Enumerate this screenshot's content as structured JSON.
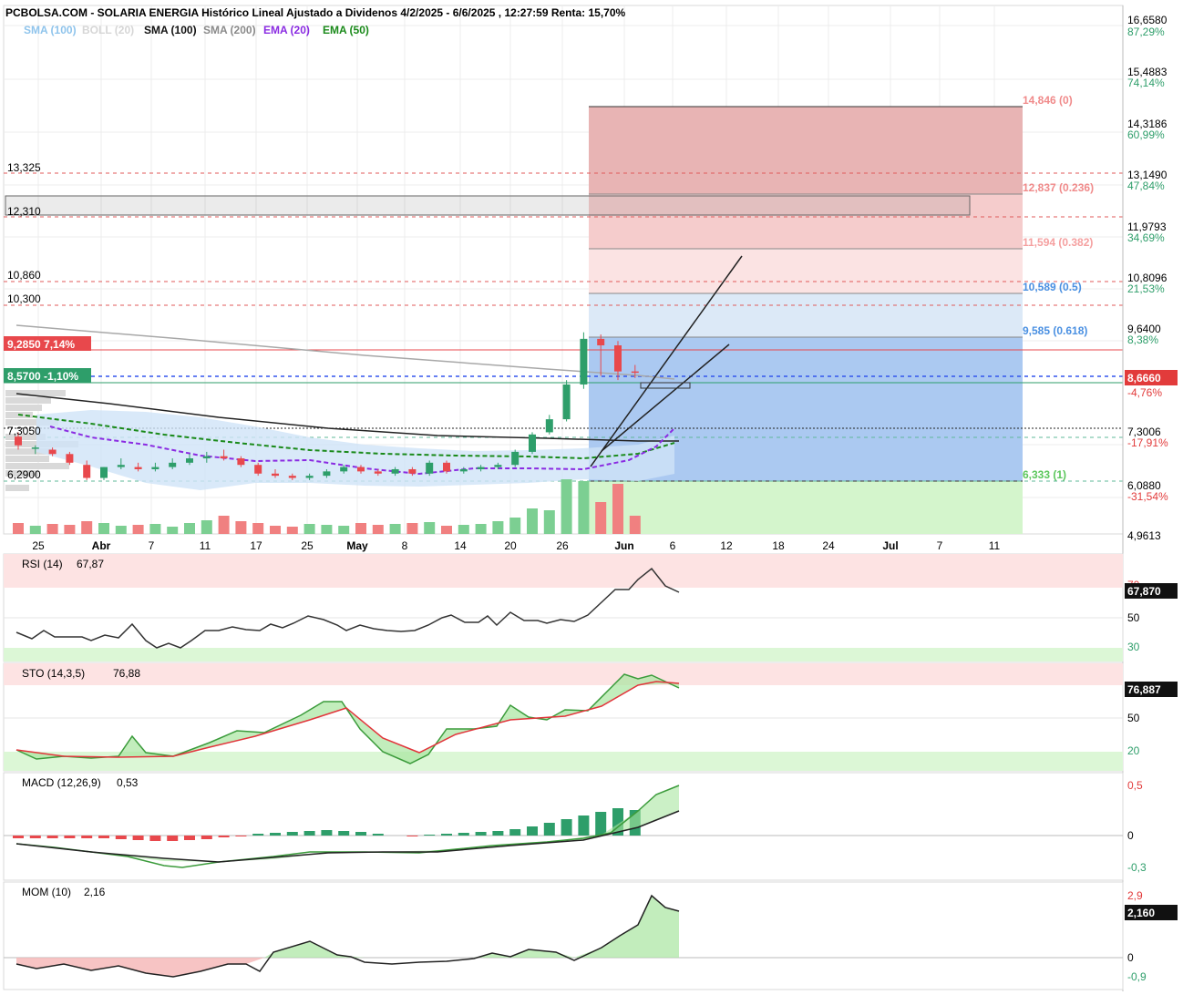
{
  "header": {
    "title": "PCBOLSA.COM - SOLARIA ENERGIA Histórico Lineal Ajustado a Dividenos 4/2/2025 - 6/6/2025 , 12:27:59 Renta: 15,70%",
    "legend": [
      {
        "label": "SMA (100)",
        "color": "#8fc4ec"
      },
      {
        "label": "BOLL (20)",
        "color": "#d6d6d6"
      },
      {
        "label": "SMA (100)",
        "color": "#111111"
      },
      {
        "label": "SMA (200)",
        "color": "#8a8a8a"
      },
      {
        "label": "EMA (20)",
        "color": "#8a2be2"
      },
      {
        "label": "EMA (50)",
        "color": "#1a8a1a"
      }
    ]
  },
  "price_axis": [
    {
      "price": "16,6580",
      "pct": "87,29%"
    },
    {
      "price": "15,4883",
      "pct": "74,14%"
    },
    {
      "price": "14,3186",
      "pct": "60,99%"
    },
    {
      "price": "13,1490",
      "pct": "47,84%"
    },
    {
      "price": "11,9793",
      "pct": "34,69%"
    },
    {
      "price": "10,8096",
      "pct": "21,53%"
    },
    {
      "price": "9,6400",
      "pct": "8,38%"
    },
    {
      "price": "7,3006",
      "pct": "-17,91%"
    },
    {
      "price": "6,0880",
      "pct": "-31,54%"
    },
    {
      "price": "4,9613",
      "pct": ""
    }
  ],
  "current_price": {
    "value": "8,6660",
    "pct": "-4,76%",
    "color": "#e23b3b"
  },
  "left_tags": [
    {
      "label": "13,325"
    },
    {
      "label": "12,310"
    },
    {
      "label": "10,860"
    },
    {
      "label": "10,300"
    },
    {
      "label": "9,2850  7,14%",
      "bg": "#e8484c"
    },
    {
      "label": "8,5700  -1,10%",
      "bg": "#2e9e6a"
    },
    {
      "label": "7,3050"
    },
    {
      "label": "6,2900"
    }
  ],
  "fib_levels": [
    {
      "label": "14,846 (0)",
      "color": "#f08a8a"
    },
    {
      "label": "12,837 (0.236)",
      "color": "#f08a8a"
    },
    {
      "label": "11,594 (0.382)",
      "color": "#f5a0a0"
    },
    {
      "label": "10,589 (0.5)",
      "color": "#4a90e2"
    },
    {
      "label": "9,585 (0.618)",
      "color": "#4a90e2"
    },
    {
      "label": "6,333 (1)",
      "color": "#5cc75c"
    }
  ],
  "x_axis": [
    "25",
    "Abr",
    "7",
    "11",
    "17",
    "25",
    "May",
    "8",
    "14",
    "20",
    "26",
    "Jun",
    "6",
    "12",
    "18",
    "24",
    "Jul",
    "7",
    "11"
  ],
  "panels": {
    "rsi": {
      "label": "RSI (14)",
      "value": "67,87",
      "tag": "67,870",
      "levels": [
        "70",
        "50",
        "30"
      ]
    },
    "sto": {
      "label": "STO (14,3,5)",
      "value": "76,88",
      "tag": "76,887",
      "levels": [
        "50",
        "20"
      ]
    },
    "macd": {
      "label": "MACD (12,26,9)",
      "value": "0,53",
      "levels": [
        "0,5",
        "0",
        "-0,3"
      ]
    },
    "mom": {
      "label": "MOM (10)",
      "value": "2,16",
      "tag": "2,160",
      "levels": [
        "2,9",
        "0",
        "-0,9"
      ]
    }
  },
  "colors": {
    "up": "#2e9e6a",
    "down": "#e8484c",
    "grid": "#e6e6e6"
  },
  "chart_data": {
    "type": "candlestick",
    "title": "SOLARIA ENERGIA Histórico Lineal Ajustado a Dividenos 4/2/2025 - 6/6/2025",
    "ylim": [
      4.9613,
      16.658
    ],
    "candles": [
      [
        7.2,
        7.3,
        6.9,
        7.0
      ],
      [
        6.95,
        7.0,
        6.8,
        6.95
      ],
      [
        6.9,
        6.95,
        6.75,
        6.8
      ],
      [
        6.8,
        6.85,
        6.55,
        6.6
      ],
      [
        6.55,
        6.65,
        6.2,
        6.25
      ],
      [
        6.25,
        6.5,
        6.2,
        6.5
      ],
      [
        6.5,
        6.7,
        6.45,
        6.55
      ],
      [
        6.5,
        6.6,
        6.4,
        6.45
      ],
      [
        6.45,
        6.6,
        6.4,
        6.5
      ],
      [
        6.5,
        6.7,
        6.45,
        6.6
      ],
      [
        6.6,
        6.8,
        6.55,
        6.7
      ],
      [
        6.7,
        6.85,
        6.6,
        6.75
      ],
      [
        6.75,
        6.9,
        6.65,
        6.7
      ],
      [
        6.7,
        6.75,
        6.5,
        6.55
      ],
      [
        6.55,
        6.6,
        6.3,
        6.35
      ],
      [
        6.35,
        6.45,
        6.25,
        6.3
      ],
      [
        6.3,
        6.35,
        6.2,
        6.25
      ],
      [
        6.25,
        6.35,
        6.2,
        6.3
      ],
      [
        6.3,
        6.45,
        6.25,
        6.4
      ],
      [
        6.4,
        6.55,
        6.35,
        6.5
      ],
      [
        6.5,
        6.55,
        6.35,
        6.4
      ],
      [
        6.4,
        6.45,
        6.3,
        6.35
      ],
      [
        6.35,
        6.5,
        6.3,
        6.45
      ],
      [
        6.45,
        6.5,
        6.3,
        6.35
      ],
      [
        6.35,
        6.65,
        6.3,
        6.6
      ],
      [
        6.6,
        6.65,
        6.35,
        6.4
      ],
      [
        6.4,
        6.5,
        6.35,
        6.45
      ],
      [
        6.45,
        6.55,
        6.4,
        6.5
      ],
      [
        6.5,
        6.6,
        6.45,
        6.55
      ],
      [
        6.55,
        6.9,
        6.5,
        6.85
      ],
      [
        6.85,
        7.3,
        6.8,
        7.25
      ],
      [
        7.3,
        7.7,
        7.25,
        7.6
      ],
      [
        7.6,
        8.5,
        7.55,
        8.4
      ],
      [
        8.4,
        9.6,
        8.3,
        9.45
      ],
      [
        9.45,
        9.55,
        8.6,
        9.3
      ],
      [
        9.3,
        9.4,
        8.5,
        8.7
      ],
      [
        8.7,
        8.85,
        8.55,
        8.67
      ]
    ]
  }
}
